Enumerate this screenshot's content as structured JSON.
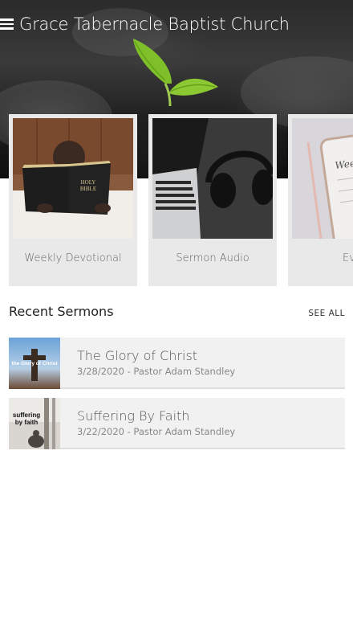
{
  "header": {
    "title": "Grace Tabernacle Baptist Church",
    "menu_icon": "hamburger-menu-icon"
  },
  "cards": [
    {
      "label": "Weekly Devotional",
      "image": "child-reading-bible"
    },
    {
      "label": "Sermon Audio",
      "image": "laptop-headphones"
    },
    {
      "label": "Eve",
      "image": "tablet-notes"
    }
  ],
  "bible_cover": "HOLY BIBLE",
  "tablet_text": "Weekly",
  "recent_sermons": {
    "title": "Recent Sermons",
    "see_all": "SEE ALL",
    "items": [
      {
        "title": "The Glory of Christ",
        "meta": "3/28/2020 - Pastor Adam Standley",
        "thumb_text": "the Glory of Christ"
      },
      {
        "title": "Suffering By Faith",
        "meta": "3/22/2020 - Pastor Adam Standley",
        "thumb_text": "suffering by faith"
      }
    ]
  },
  "colors": {
    "card_bg": "#e9e9e9",
    "list_bg": "#f1f1f1",
    "leaf_green": "#7fbf2a"
  }
}
